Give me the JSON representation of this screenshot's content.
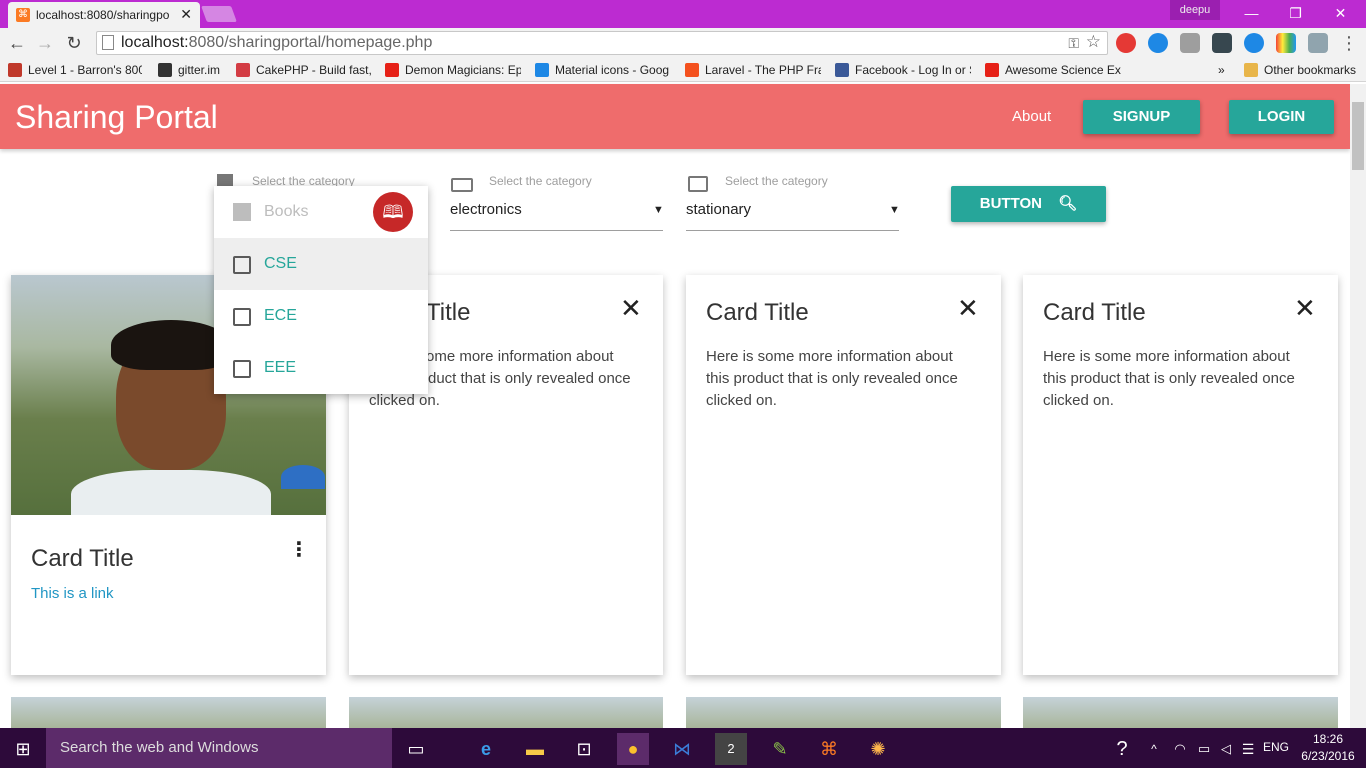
{
  "browser": {
    "tab_title": "localhost:8080/sharingpo",
    "profile": "deepu",
    "url_host": "localhost:",
    "url_path": "8080/sharingportal/homepage.php",
    "bookmarks": [
      {
        "label": "Level 1 - Barron's 800",
        "color": "#c0392b"
      },
      {
        "label": "gitter.im",
        "color": "#333333"
      },
      {
        "label": "CakePHP - Build fast,",
        "color": "#d33c44"
      },
      {
        "label": "Demon Magicians: Ep",
        "color": "#e62117"
      },
      {
        "label": "Material icons - Goog",
        "color": "#1e88e5"
      },
      {
        "label": "Laravel - The PHP Fran",
        "color": "#f4511e"
      },
      {
        "label": "Facebook - Log In or S",
        "color": "#3b5998"
      },
      {
        "label": "Awesome Science Exp",
        "color": "#e62117"
      }
    ],
    "bookmarks_overflow": "»",
    "other_bookmarks": "Other bookmarks"
  },
  "header": {
    "brand": "Sharing Portal",
    "about": "About",
    "signup": "SIGNUP",
    "login": "LOGIN"
  },
  "filters": {
    "select1": {
      "label": "Select the category"
    },
    "select2": {
      "label": "Select the category",
      "value": "electronics"
    },
    "select3": {
      "label": "Select the category",
      "value": "stationary"
    },
    "button": "BUTTON"
  },
  "dropdown": {
    "header": "Books",
    "items": [
      "CSE",
      "ECE",
      "EEE"
    ]
  },
  "cards": {
    "image_card": {
      "title": "Card Title",
      "link": "This is a link"
    },
    "reveal": [
      {
        "title": "Card Title",
        "body": "Here is some more information about this product that is only revealed once clicked on."
      },
      {
        "title": "Card Title",
        "body": "Here is some more information about this product that is only revealed once clicked on."
      },
      {
        "title": "Card Title",
        "body": "Here is some more information about this product that is only revealed once clicked on."
      }
    ],
    "card2_title_visible": "Title",
    "card2_body_lines": [
      "ome more information about",
      "duct that is only revealed once",
      "clicked on."
    ]
  },
  "taskbar": {
    "search_placeholder": "Search the web and Windows",
    "lang": "ENG",
    "time": "18:26",
    "date": "6/23/2016"
  },
  "colors": {
    "header": "#ef6c6c",
    "accent": "#26a69a",
    "browser_frame": "#bc2bd1"
  }
}
